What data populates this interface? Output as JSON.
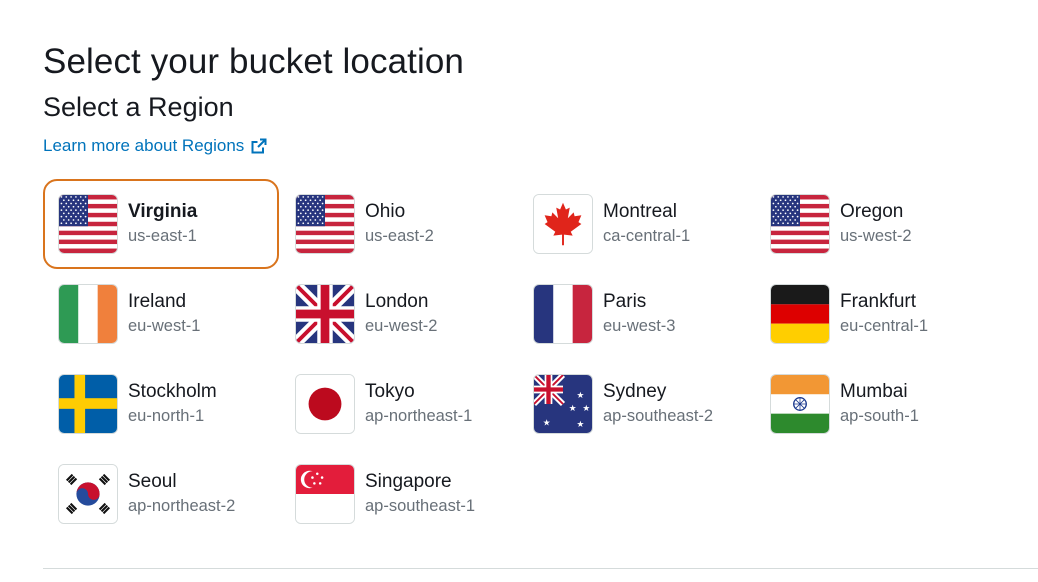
{
  "header": {
    "title": "Select your bucket location",
    "section_title": "Select a Region",
    "learn_more": "Learn more about Regions"
  },
  "colors": {
    "link": "#0073bb",
    "selected_border": "#d9741d",
    "code_text": "#687078"
  },
  "regions": [
    {
      "name": "Virginia",
      "code": "us-east-1",
      "flag": "usa-flag-icon",
      "selected": true
    },
    {
      "name": "Ohio",
      "code": "us-east-2",
      "flag": "usa-flag-icon",
      "selected": false
    },
    {
      "name": "Montreal",
      "code": "ca-central-1",
      "flag": "canada-flag-icon",
      "selected": false
    },
    {
      "name": "Oregon",
      "code": "us-west-2",
      "flag": "usa-flag-icon",
      "selected": false
    },
    {
      "name": "Ireland",
      "code": "eu-west-1",
      "flag": "ireland-flag-icon",
      "selected": false
    },
    {
      "name": "London",
      "code": "eu-west-2",
      "flag": "uk-flag-icon",
      "selected": false
    },
    {
      "name": "Paris",
      "code": "eu-west-3",
      "flag": "france-flag-icon",
      "selected": false
    },
    {
      "name": "Frankfurt",
      "code": "eu-central-1",
      "flag": "germany-flag-icon",
      "selected": false
    },
    {
      "name": "Stockholm",
      "code": "eu-north-1",
      "flag": "sweden-flag-icon",
      "selected": false
    },
    {
      "name": "Tokyo",
      "code": "ap-northeast-1",
      "flag": "japan-flag-icon",
      "selected": false
    },
    {
      "name": "Sydney",
      "code": "ap-southeast-2",
      "flag": "australia-flag-icon",
      "selected": false
    },
    {
      "name": "Mumbai",
      "code": "ap-south-1",
      "flag": "india-flag-icon",
      "selected": false
    },
    {
      "name": "Seoul",
      "code": "ap-northeast-2",
      "flag": "south-korea-flag-icon",
      "selected": false
    },
    {
      "name": "Singapore",
      "code": "ap-southeast-1",
      "flag": "singapore-flag-icon",
      "selected": false
    }
  ]
}
